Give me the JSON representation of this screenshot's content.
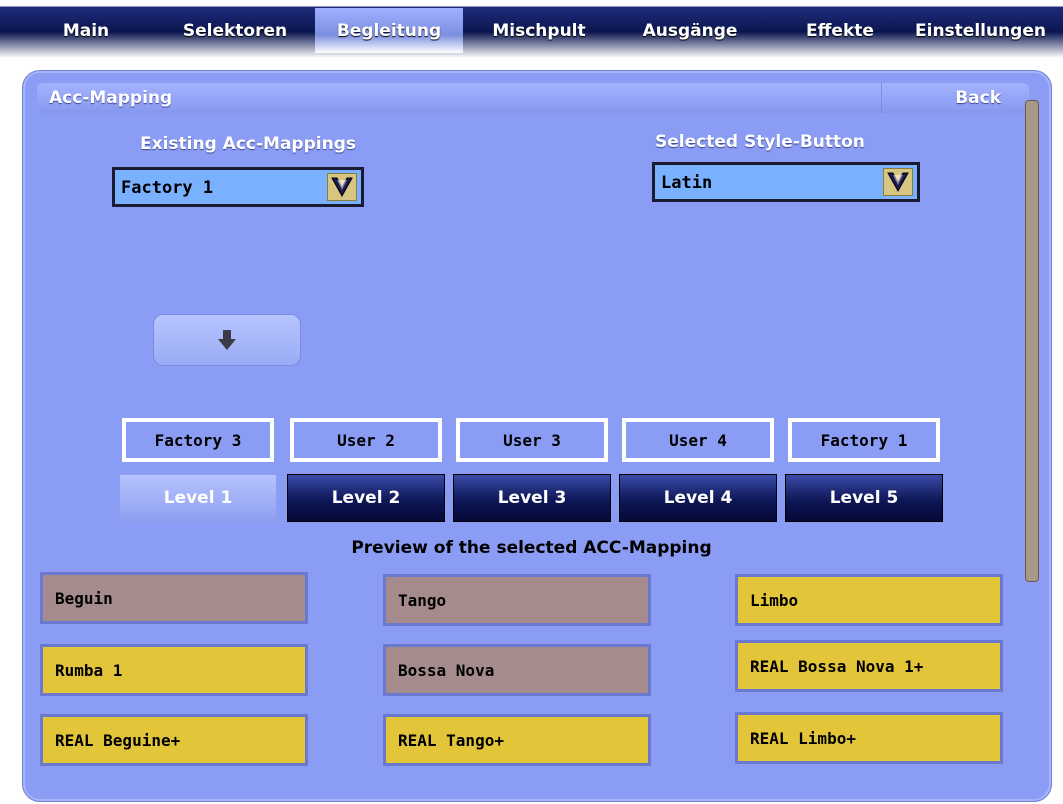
{
  "tabs": [
    {
      "label": "Main",
      "active": false
    },
    {
      "label": "Selektoren",
      "active": false
    },
    {
      "label": "Begleitung",
      "active": true
    },
    {
      "label": "Mischpult",
      "active": false
    },
    {
      "label": "Ausgänge",
      "active": false
    },
    {
      "label": "Effekte",
      "active": false
    },
    {
      "label": "Einstellungen",
      "active": false
    }
  ],
  "panel": {
    "title": "Acc-Mapping",
    "back_label": "Back"
  },
  "existing": {
    "label": "Existing Acc-Mappings",
    "value": "Factory 1"
  },
  "style_button": {
    "label": "Selected Style-Button",
    "value": "Latin"
  },
  "apply_icon": "down-arrow-icon",
  "slots": [
    "Factory 3",
    "User 2",
    "User 3",
    "User 4",
    "Factory 1"
  ],
  "levels": [
    {
      "label": "Level 1",
      "active": true
    },
    {
      "label": "Level 2",
      "active": false
    },
    {
      "label": "Level 3",
      "active": false
    },
    {
      "label": "Level 4",
      "active": false
    },
    {
      "label": "Level 5",
      "active": false
    }
  ],
  "preview": {
    "title": "Preview of the selected ACC-Mapping",
    "columns": [
      [
        {
          "label": "Beguin",
          "color": "gray"
        },
        {
          "label": "Rumba 1",
          "color": "yellow"
        },
        {
          "label": "REAL Beguine+",
          "color": "yellow"
        }
      ],
      [
        {
          "label": "Tango",
          "color": "gray"
        },
        {
          "label": "Bossa Nova",
          "color": "gray"
        },
        {
          "label": "REAL Tango+",
          "color": "yellow"
        }
      ],
      [
        {
          "label": "Limbo",
          "color": "yellow"
        },
        {
          "label": "REAL Bossa Nova 1+",
          "color": "yellow"
        },
        {
          "label": "REAL Limbo+",
          "color": "yellow"
        }
      ]
    ]
  },
  "colors": {
    "panel_bg": "#8a9cf3",
    "tab_bar": "#0b1650",
    "style_yellow": "#e3c53a",
    "style_gray": "#a58b8b"
  }
}
